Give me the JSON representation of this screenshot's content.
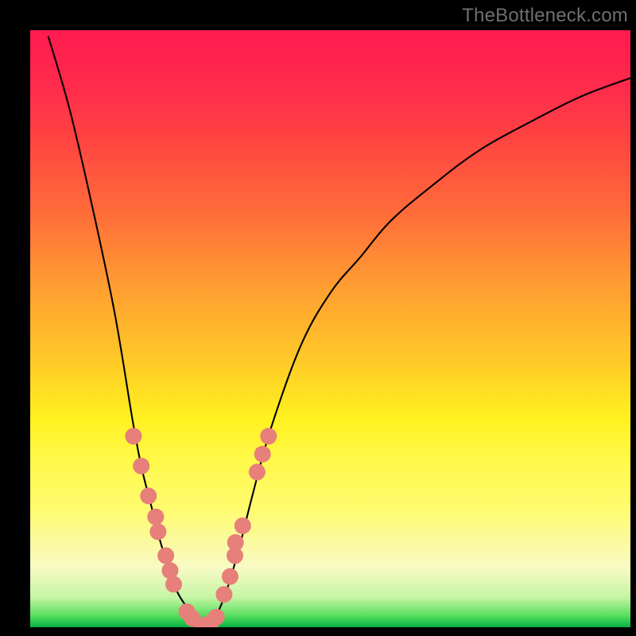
{
  "attribution": "TheBottleneck.com",
  "chart_data": {
    "type": "line",
    "title": "",
    "xlabel": "",
    "ylabel": "",
    "xlim": [
      0,
      100
    ],
    "ylim": [
      0,
      100
    ],
    "series": [
      {
        "name": "left-curve",
        "x": [
          3.0,
          6.5,
          10,
          14,
          17,
          18.5,
          20,
          21.5,
          23,
          24,
          25,
          26,
          27,
          28,
          29
        ],
        "values": [
          99,
          87,
          72,
          53,
          35,
          27,
          21,
          15,
          10,
          7,
          5,
          3.5,
          2,
          1,
          0
        ]
      },
      {
        "name": "right-curve",
        "x": [
          29,
          31,
          33,
          35,
          37,
          40,
          45,
          50,
          55,
          60,
          67,
          75,
          84,
          92,
          100
        ],
        "values": [
          0,
          2,
          7,
          14,
          22,
          33,
          47,
          56,
          62,
          68,
          74,
          80,
          85,
          89,
          92
        ]
      }
    ],
    "markers": [
      {
        "x": 17.2,
        "y": 32,
        "cluster": "left"
      },
      {
        "x": 18.5,
        "y": 27,
        "cluster": "left"
      },
      {
        "x": 19.7,
        "y": 22,
        "cluster": "left"
      },
      {
        "x": 20.9,
        "y": 18.5,
        "cluster": "left"
      },
      {
        "x": 21.3,
        "y": 16,
        "cluster": "left"
      },
      {
        "x": 22.6,
        "y": 12,
        "cluster": "left"
      },
      {
        "x": 23.3,
        "y": 9.5,
        "cluster": "left"
      },
      {
        "x": 23.9,
        "y": 7.2,
        "cluster": "left"
      },
      {
        "x": 26.1,
        "y": 2.6,
        "cluster": "left"
      },
      {
        "x": 27.0,
        "y": 1.5,
        "cluster": "bottom"
      },
      {
        "x": 28.6,
        "y": 0.3,
        "cluster": "bottom"
      },
      {
        "x": 30.1,
        "y": 0.8,
        "cluster": "bottom"
      },
      {
        "x": 31.0,
        "y": 1.7,
        "cluster": "bottom"
      },
      {
        "x": 32.3,
        "y": 5.5,
        "cluster": "right"
      },
      {
        "x": 33.3,
        "y": 8.5,
        "cluster": "right"
      },
      {
        "x": 34.1,
        "y": 12,
        "cluster": "right"
      },
      {
        "x": 34.2,
        "y": 14.2,
        "cluster": "right"
      },
      {
        "x": 35.4,
        "y": 17,
        "cluster": "right"
      },
      {
        "x": 37.8,
        "y": 26,
        "cluster": "right"
      },
      {
        "x": 38.7,
        "y": 29,
        "cluster": "right"
      },
      {
        "x": 39.7,
        "y": 32,
        "cluster": "right"
      }
    ],
    "marker_color": "#e77f7a",
    "marker_radius_px": 10.5,
    "curve_stroke": "#000000",
    "curve_stroke_width_px": 2.1
  }
}
